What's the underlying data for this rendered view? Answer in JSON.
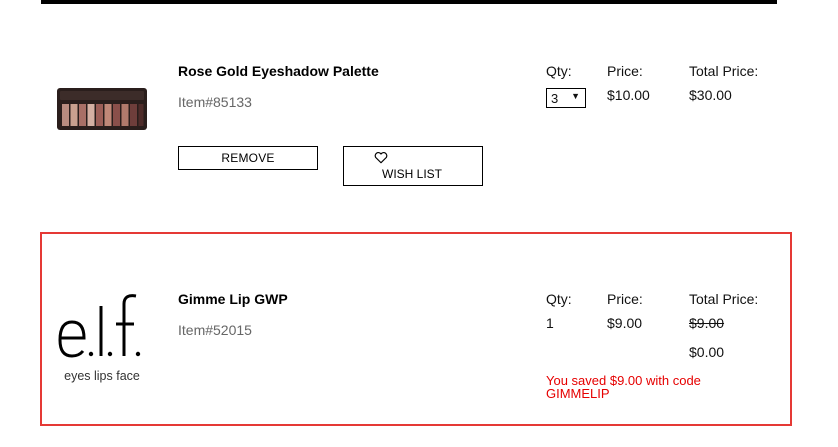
{
  "columns": {
    "qty": "Qty:",
    "price": "Price:",
    "total": "Total Price:"
  },
  "items": [
    {
      "name": "Rose Gold Eyeshadow Palette",
      "item_number": "Item#85133",
      "qty": "3",
      "price": "$10.00",
      "total": "$30.00",
      "remove_label": "REMOVE",
      "wishlist_label": "WISH LIST",
      "image": "eyeshadow-palette-image",
      "wishlist_icon": "heart-icon"
    },
    {
      "name": "Gimme Lip GWP",
      "item_number": "Item#52015",
      "qty": "1",
      "price": "$9.00",
      "original_total": "$9.00",
      "total": "$0.00",
      "savings_line1": "You saved $9.00 with code",
      "savings_line2": "GIMMELIP",
      "logo_text": "e.l.f.",
      "logo_tagline": "eyes lips face",
      "highlight_color": "#e53935",
      "savings_color": "#e60000"
    }
  ]
}
